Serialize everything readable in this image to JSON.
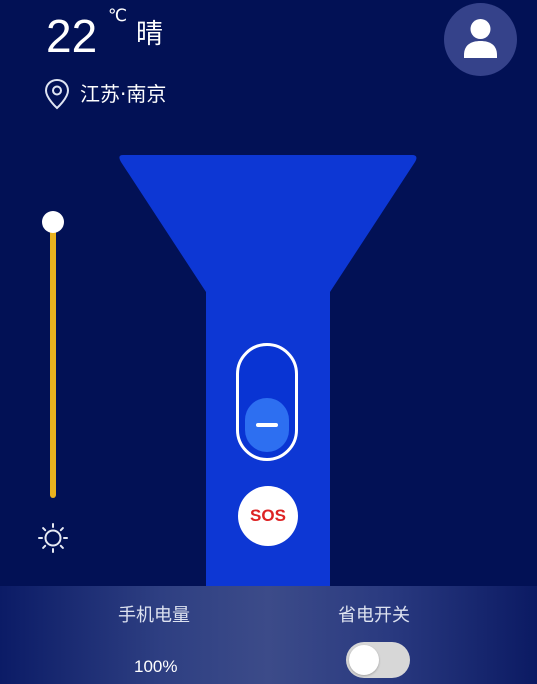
{
  "weather": {
    "temperature": "22",
    "unit": "℃",
    "condition": "晴",
    "location": "江苏·南京"
  },
  "icons": {
    "location": "map-pin-icon",
    "user": "user-avatar-icon",
    "brightness": "sun-icon"
  },
  "brightness": {
    "level": 1.0
  },
  "flashlight": {
    "power": "off",
    "sos_label": "SOS"
  },
  "footer": {
    "battery_label": "手机电量",
    "battery_value": "100%",
    "power_save_label": "省电开关",
    "power_save_on": false
  },
  "colors": {
    "background": "#021155",
    "torch": "#0d37d4",
    "slider": "#e9b21e",
    "sos_text": "#dd2324"
  }
}
